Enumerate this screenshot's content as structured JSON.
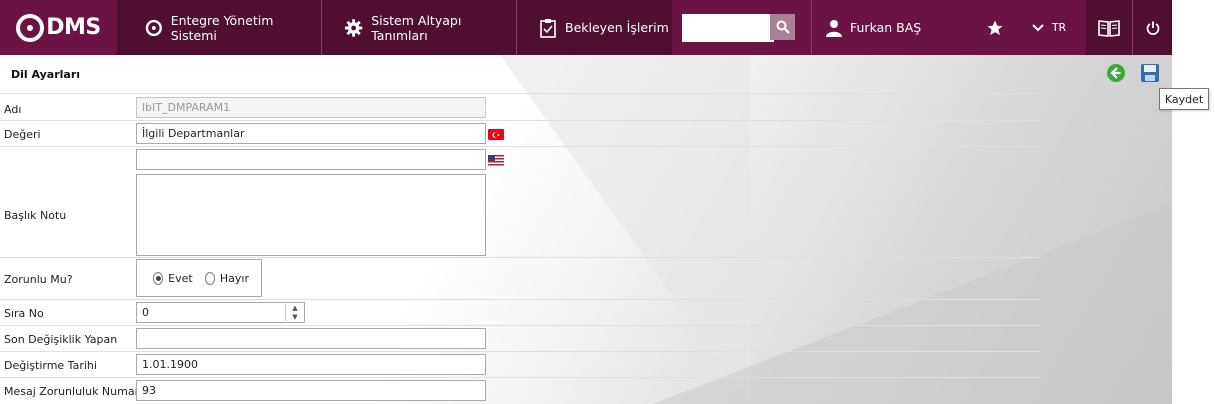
{
  "nav": {
    "logo_text": "DMS",
    "items": [
      {
        "label": "Entegre Yönetim Sistemi",
        "icon": "q-logo-icon"
      },
      {
        "label": "Sistem Altyapı Tanımları",
        "icon": "gear-icon"
      },
      {
        "label": "Bekleyen İşlerim",
        "icon": "clipboard-icon"
      }
    ],
    "search_placeholder": "",
    "user_name": "Furkan BAŞ",
    "language": "TR"
  },
  "page": {
    "title": "Dil Ayarları",
    "tooltip": "Kaydet"
  },
  "form": {
    "name_label": "Adı",
    "name_value": "lbIT_DMPARAM1",
    "value_label": "Değeri",
    "value_tr": "İlgili Departmanlar",
    "value_en": "",
    "note_label": "Başlık Notu",
    "note_value": "",
    "required_label": "Zorunlu Mu?",
    "required_yes": "Evet",
    "required_no": "Hayır",
    "order_label": "Sıra No",
    "order_value": "0",
    "modified_by_label": "Son Değişiklik Yapan",
    "modified_by_value": "",
    "modified_date_label": "Değiştirme Tarihi",
    "modified_date_value": "1.01.1900",
    "msg_required_label": "Mesaj Zorunluluk Numarası",
    "msg_required_value": "93"
  },
  "colors": {
    "nav_bg": "#6b1444",
    "nav_dark": "#4e0f31",
    "back_icon": "#3aa93a"
  }
}
